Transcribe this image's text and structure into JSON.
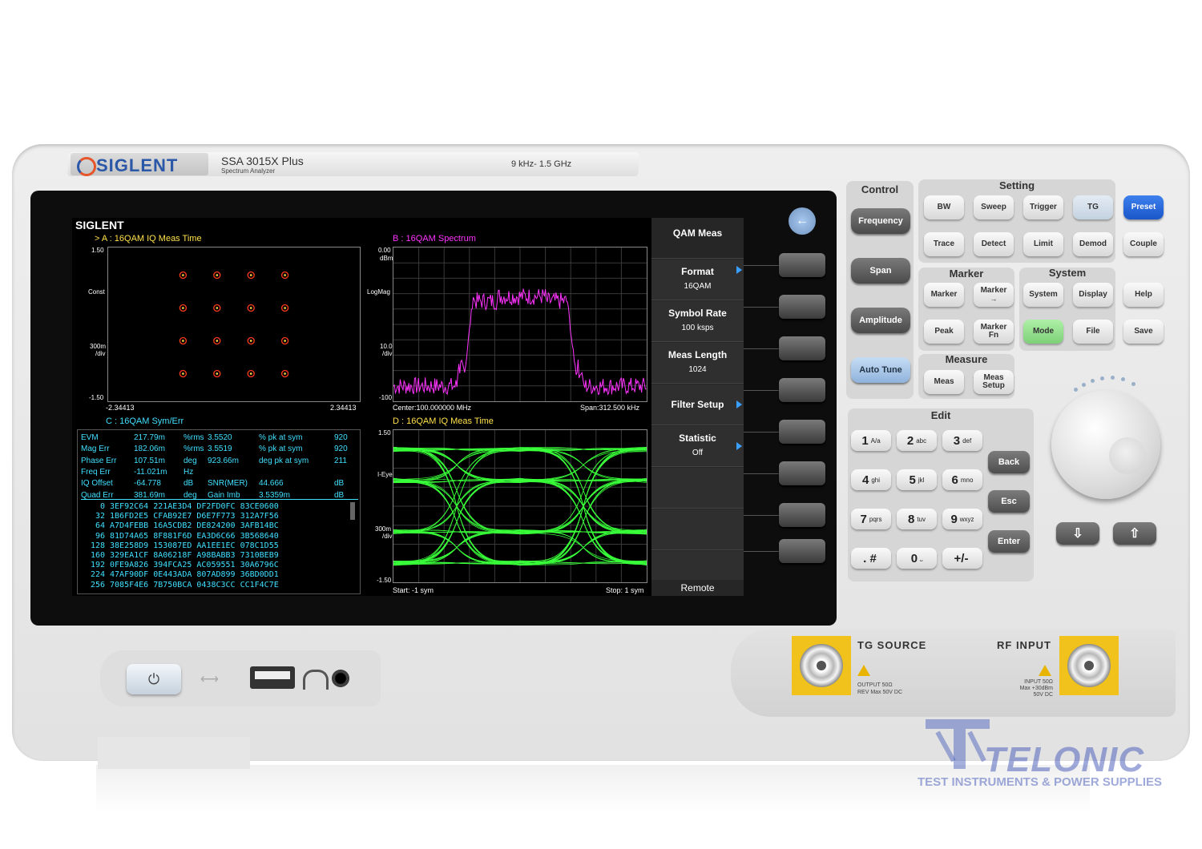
{
  "device": {
    "brand": "SIGLENT",
    "model": "SSA 3015X Plus",
    "model_sub": "Spectrum  Analyzer",
    "freq_range": "9 kHz-  1.5 GHz"
  },
  "screen": {
    "logo": "SIGLENT",
    "panel_a": {
      "title": "> A :  16QAM  IQ Meas Time",
      "y_top": "1.50",
      "y_mid": "Const",
      "y_scale_1": "300m",
      "y_scale_2": "/div",
      "y_bottom": "-1.50",
      "x_left": "-2.34413",
      "x_right": "2.34413"
    },
    "panel_b": {
      "title": "B :  16QAM  Spectrum",
      "y_top": "0.00",
      "y_unit": "dBm",
      "y_mode": "LogMag",
      "y_scale_1": "10.0",
      "y_scale_2": "/div",
      "y_bottom": "-100",
      "center": "Center:100.000000 MHz",
      "span": "Span:312.500 kHz"
    },
    "panel_c": {
      "title": "C :  16QAM  Sym/Err",
      "rows": [
        [
          "EVM",
          "217.79m",
          "%rms",
          "3.5520",
          "% pk at sym",
          "920"
        ],
        [
          "Mag Err",
          "182.06m",
          "%rms",
          "3.5519",
          "% pk at sym",
          "920"
        ],
        [
          "Phase Err",
          "107.51m",
          "deg",
          "923.66m",
          "deg pk at sym",
          "211"
        ],
        [
          "Freq Err",
          "-11.021m",
          "Hz",
          "",
          "",
          ""
        ],
        [
          "IQ Offset",
          "-64.778",
          "dB",
          "SNR(MER)",
          "44.666",
          "dB"
        ],
        [
          "Quad Err",
          "381.69m",
          "deg",
          "Gain Imb",
          "3.5359m",
          "dB"
        ]
      ],
      "symbols": [
        [
          "0",
          "3EF92C64",
          "221AE3D4",
          "DF2FD0FC",
          "83CE0600"
        ],
        [
          "32",
          "1B6FD2E5",
          "CFAB92E7",
          "D6E7F773",
          "312A7F56"
        ],
        [
          "64",
          "A7D4FEBB",
          "16A5CDB2",
          "DE824200",
          "3AFB14BC"
        ],
        [
          "96",
          "81D74A65",
          "8F881F6D",
          "EA3D6C66",
          "3B568640"
        ],
        [
          "128",
          "38E258D9",
          "153087ED",
          "AA1EE1EC",
          "078C1D55"
        ],
        [
          "160",
          "329EA1CF",
          "8A06218F",
          "A98BABB3",
          "7310BEB9"
        ],
        [
          "192",
          "0FE9A826",
          "394FCA25",
          "AC059551",
          "30A6796C"
        ],
        [
          "224",
          "47AF90DF",
          "0E443ADA",
          "807AD899",
          "36BD0DD1"
        ],
        [
          "256",
          "7085F4E6",
          "7B750BCA",
          "0438C3CC",
          "CC1F4C7E"
        ]
      ]
    },
    "panel_d": {
      "title": "D :  16QAM  IQ Meas Time",
      "y_top": "1.50",
      "y_mid": "I-Eye",
      "y_scale_1": "300m",
      "y_scale_2": "/div",
      "y_bottom": "-1.50",
      "start": "Start: -1 sym",
      "stop": "Stop: 1 sym"
    },
    "menu": {
      "title": "QAM Meas",
      "items": [
        {
          "label": "Format",
          "value": "16QAM"
        },
        {
          "label": "Symbol Rate",
          "value": "100 ksps"
        },
        {
          "label": "Meas Length",
          "value": "1024"
        },
        {
          "label": "Filter Setup",
          "value": ""
        },
        {
          "label": "Statistic",
          "value": "Off"
        }
      ],
      "footer": "Remote"
    }
  },
  "panel": {
    "control": {
      "title": "Control",
      "frequency": "Frequency",
      "span": "Span",
      "amplitude": "Amplitude",
      "auto_tune": "Auto Tune"
    },
    "setting": {
      "title": "Setting",
      "bw": "BW",
      "sweep": "Sweep",
      "trigger": "Trigger",
      "tg": "TG",
      "trace": "Trace",
      "detect": "Detect",
      "limit": "Limit",
      "demod": "Demod"
    },
    "marker": {
      "title": "Marker",
      "marker": "Marker",
      "marker_to": "Marker",
      "peak": "Peak",
      "marker_fn_1": "Marker",
      "marker_fn_2": "Fn"
    },
    "system": {
      "title": "System",
      "system": "System",
      "display": "Display",
      "mode": "Mode",
      "file": "File"
    },
    "measure": {
      "title": "Measure",
      "meas": "Meas",
      "meas_setup_1": "Meas",
      "meas_setup_2": "Setup"
    },
    "right": {
      "preset": "Preset",
      "couple": "Couple",
      "help": "Help",
      "save": "Save"
    },
    "edit": {
      "title": "Edit",
      "keys": [
        {
          "n": "1",
          "l": "A/a"
        },
        {
          "n": "2",
          "l": "abc"
        },
        {
          "n": "3",
          "l": "def"
        },
        {
          "n": "4",
          "l": "ghi"
        },
        {
          "n": "5",
          "l": "jkl"
        },
        {
          "n": "6",
          "l": "mno"
        },
        {
          "n": "7",
          "l": "pqrs"
        },
        {
          "n": "8",
          "l": "tuv"
        },
        {
          "n": "9",
          "l": "wxyz"
        },
        {
          "n": ". #",
          "l": ""
        },
        {
          "n": "0",
          "l": "⎵"
        },
        {
          "n": "+/-",
          "l": ""
        }
      ],
      "back": "Back",
      "esc": "Esc",
      "enter": "Enter"
    }
  },
  "ports": {
    "tg_source": "TG SOURCE",
    "tg_note_1": "OUTPUT 50Ω",
    "tg_note_2": "REV Max 50V DC",
    "rf_input": "RF INPUT",
    "rf_note_1": "INPUT 50Ω",
    "rf_note_2": "Max +30dBm",
    "rf_note_3": "50V DC"
  },
  "watermark": {
    "name": "TELONIC",
    "tagline": "TEST INSTRUMENTS & POWER SUPPLIES"
  },
  "colors": {
    "trace_a": "#ffe14a",
    "trace_b": "#ff33ff",
    "trace_d": "#39ff3a",
    "preset": "#1f63d6",
    "mode": "#8fe08a",
    "auto_tune": "#a8c8ee"
  }
}
